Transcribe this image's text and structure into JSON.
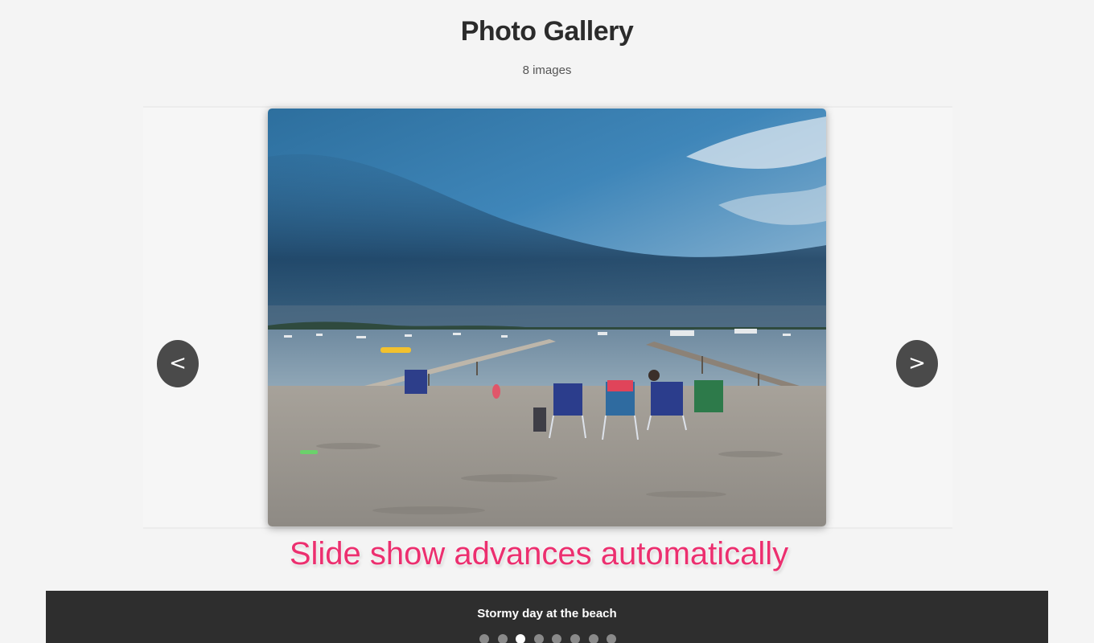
{
  "gallery": {
    "title": "Photo Gallery",
    "count_label": "8 images"
  },
  "slideshow": {
    "prev_label": "<",
    "next_label": ">",
    "caption": "Stormy day at the beach",
    "total_slides": 8,
    "active_index": 2
  },
  "annotation": {
    "text": "Slide show advances automatically",
    "color": "#ec2f6f"
  },
  "colors": {
    "background": "#f4f4f4",
    "caption_bar": "#2e2e2e",
    "nav_button": "#4a4a4a",
    "dot_inactive": "#8a8a8a",
    "dot_active": "#ffffff"
  }
}
